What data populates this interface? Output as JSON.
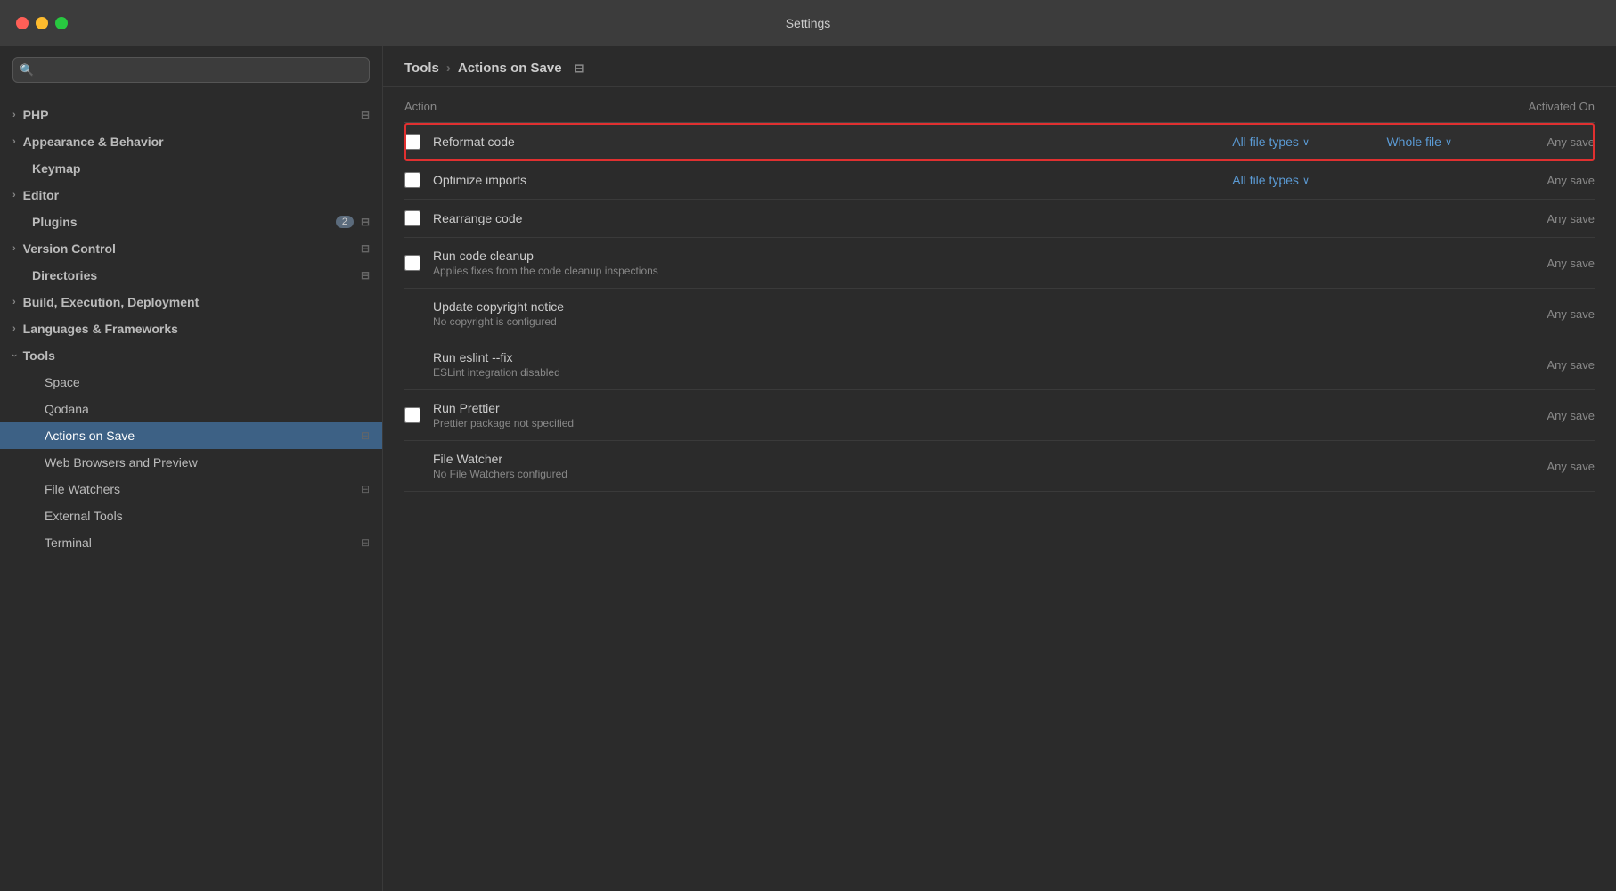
{
  "titlebar": {
    "title": "Settings"
  },
  "sidebar": {
    "search_placeholder": "🔍",
    "items": [
      {
        "id": "php",
        "label": "PHP",
        "type": "expandable",
        "indent": 0,
        "has_settings_icon": true
      },
      {
        "id": "appearance",
        "label": "Appearance & Behavior",
        "type": "expandable",
        "indent": 0
      },
      {
        "id": "keymap",
        "label": "Keymap",
        "type": "plain",
        "indent": 0
      },
      {
        "id": "editor",
        "label": "Editor",
        "type": "expandable",
        "indent": 0
      },
      {
        "id": "plugins",
        "label": "Plugins",
        "type": "plain",
        "indent": 0,
        "badge": "2",
        "has_settings_icon": true
      },
      {
        "id": "version-control",
        "label": "Version Control",
        "type": "expandable",
        "indent": 0,
        "has_settings_icon": true
      },
      {
        "id": "directories",
        "label": "Directories",
        "type": "plain",
        "indent": 0,
        "has_settings_icon": true
      },
      {
        "id": "build",
        "label": "Build, Execution, Deployment",
        "type": "expandable",
        "indent": 0
      },
      {
        "id": "languages",
        "label": "Languages & Frameworks",
        "type": "expandable",
        "indent": 0
      },
      {
        "id": "tools",
        "label": "Tools",
        "type": "open",
        "indent": 0
      },
      {
        "id": "space",
        "label": "Space",
        "type": "child",
        "indent": 1
      },
      {
        "id": "qodana",
        "label": "Qodana",
        "type": "child",
        "indent": 1
      },
      {
        "id": "actions-on-save",
        "label": "Actions on Save",
        "type": "child",
        "indent": 1,
        "active": true,
        "has_settings_icon": true
      },
      {
        "id": "web-browsers",
        "label": "Web Browsers and Preview",
        "type": "child",
        "indent": 1
      },
      {
        "id": "file-watchers",
        "label": "File Watchers",
        "type": "child",
        "indent": 1,
        "has_settings_icon": true
      },
      {
        "id": "external-tools",
        "label": "External Tools",
        "type": "child",
        "indent": 1
      },
      {
        "id": "terminal",
        "label": "Terminal",
        "type": "child",
        "indent": 1,
        "has_settings_icon": true
      }
    ]
  },
  "breadcrumb": {
    "parent": "Tools",
    "separator": "›",
    "current": "Actions on Save",
    "icon": "⊟"
  },
  "table": {
    "headers": {
      "action": "Action",
      "activated_on": "Activated On"
    },
    "rows": [
      {
        "id": "reformat-code",
        "label": "Reformat code",
        "checked": false,
        "file_types": "All file types",
        "scope": "Whole file",
        "activated": "Any save",
        "highlighted": true
      },
      {
        "id": "optimize-imports",
        "label": "Optimize imports",
        "checked": false,
        "file_types": "All file types",
        "scope": null,
        "activated": "Any save",
        "highlighted": false
      },
      {
        "id": "rearrange-code",
        "label": "Rearrange code",
        "checked": false,
        "file_types": null,
        "scope": null,
        "activated": "Any save",
        "highlighted": false
      },
      {
        "id": "run-code-cleanup",
        "label": "Run code cleanup",
        "sublabel": "Applies fixes from the code cleanup inspections",
        "checked": false,
        "file_types": null,
        "scope": null,
        "activated": "Any save",
        "highlighted": false
      },
      {
        "id": "update-copyright",
        "label": "Update copyright notice",
        "sublabel": "No copyright is configured",
        "checked": false,
        "file_types": null,
        "scope": null,
        "activated": "Any save",
        "highlighted": false,
        "no_checkbox": true
      },
      {
        "id": "run-eslint",
        "label": "Run eslint --fix",
        "sublabel": "ESLint integration disabled",
        "checked": false,
        "file_types": null,
        "scope": null,
        "activated": "Any save",
        "highlighted": false,
        "no_checkbox": true
      },
      {
        "id": "run-prettier",
        "label": "Run Prettier",
        "sublabel": "Prettier package not specified",
        "checked": false,
        "file_types": null,
        "scope": null,
        "activated": "Any save",
        "highlighted": false
      },
      {
        "id": "file-watcher",
        "label": "File Watcher",
        "sublabel": "No File Watchers configured",
        "checked": false,
        "file_types": null,
        "scope": null,
        "activated": "Any save",
        "highlighted": false,
        "no_checkbox": true
      }
    ]
  }
}
